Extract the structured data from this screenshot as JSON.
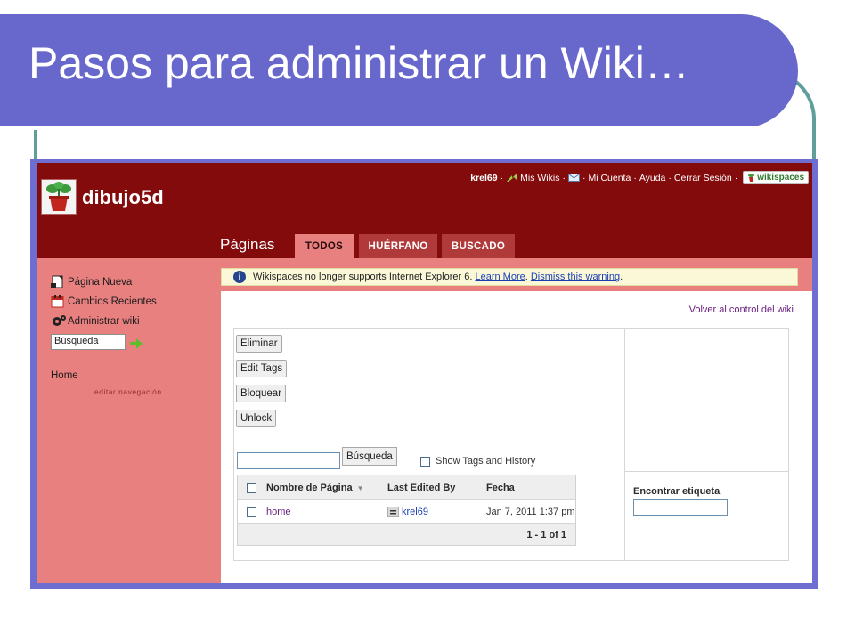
{
  "slide": {
    "title": "Pasos para administrar un Wiki…"
  },
  "colors": {
    "banner": "#6868cc",
    "header": "#830b0b",
    "sidebar": "#e88080",
    "teal": "#5f9e9a"
  },
  "site": {
    "wiki_name": "dibujo5d",
    "topnav": {
      "user": "krel69",
      "sep": "·",
      "mis_wikis": "Mis Wikis",
      "mi_cuenta": "Mi Cuenta",
      "ayuda": "Ayuda",
      "cerrar_sesion": "Cerrar Sesión",
      "brand": "wikispaces"
    },
    "section_title": "Páginas",
    "tabs": [
      "TODOS",
      "HUÉRFANO",
      "BUSCADO"
    ]
  },
  "sidebar": {
    "items": [
      {
        "label": "Página Nueva",
        "icon": "new-page-icon"
      },
      {
        "label": "Cambios Recientes",
        "icon": "calendar-icon"
      },
      {
        "label": "Administrar wiki",
        "icon": "gear-icon"
      }
    ],
    "search_value": "Búsqueda",
    "home": "Home",
    "edit_nav": "editar navegación"
  },
  "warning": {
    "text": "Wikispaces no longer supports Internet Explorer 6.",
    "learn_more": "Learn More",
    "period1": ".",
    "dismiss": "Dismiss this warning",
    "period2": "."
  },
  "main": {
    "back_link": "Volver al control del wiki",
    "buttons": [
      "Eliminar",
      "Edit Tags",
      "Bloquear",
      "Unlock"
    ],
    "search_button": "Búsqueda",
    "show_tags": "Show Tags and History",
    "table": {
      "headers": [
        "Nombre de Página",
        "Last Edited By",
        "Fecha"
      ],
      "rows": [
        {
          "name": "home",
          "editor": "krel69",
          "date": "Jan 7, 2011 1:37 pm"
        }
      ],
      "pager": "1 - 1 of 1"
    },
    "tag_search_label": "Encontrar etiqueta"
  }
}
